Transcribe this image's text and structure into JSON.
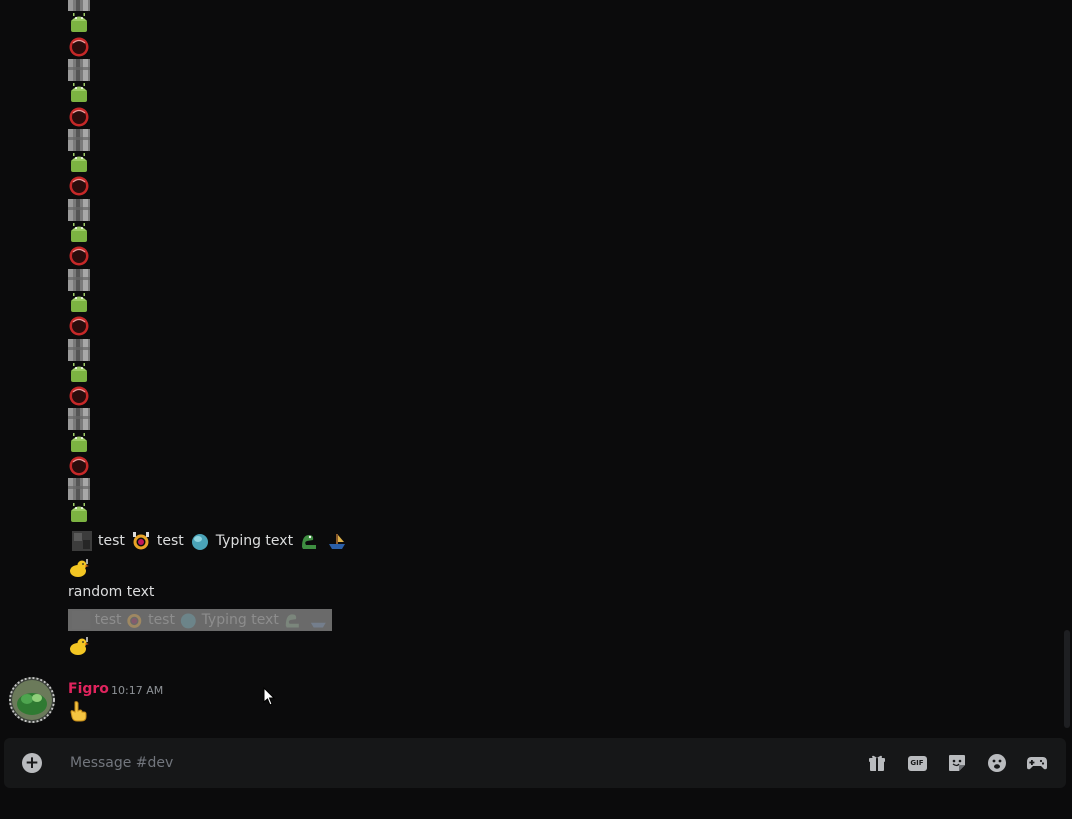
{
  "channel": {
    "composer_placeholder": "Message #dev"
  },
  "messages": {
    "line1": {
      "words": [
        "test",
        "test",
        "Typing text"
      ]
    },
    "random_text": "random text",
    "line_highlight": {
      "words": [
        "test",
        "test",
        "Typing text"
      ]
    },
    "author": {
      "username": "Figro",
      "timestamp": "10:17 AM"
    }
  },
  "icons": {
    "add": "plus-circle-icon",
    "gift": "gift-icon",
    "gif": "gif-icon",
    "gif_label": "GIF",
    "sticker": "sticker-icon",
    "emoji": "emoji-icon",
    "game": "gamepad-icon"
  },
  "colors": {
    "username": "#e0245e",
    "background": "#0b0b0c",
    "composer": "#161718"
  }
}
